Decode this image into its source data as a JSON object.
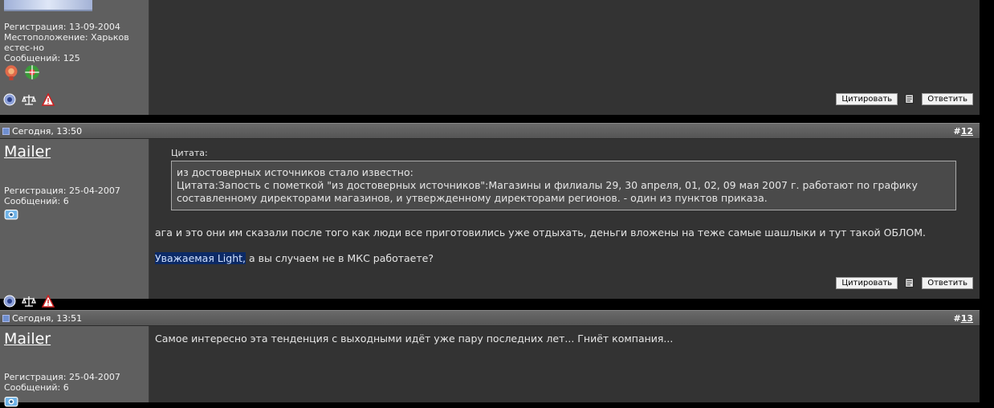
{
  "post11": {
    "registration": "Регистрация: 13-09-2004",
    "location": "Местоположение: Харьков",
    "location_extra": "естес-но",
    "messages": "Сообщений: 125",
    "quote_button": "Цитировать",
    "reply_button": "Ответить"
  },
  "post12": {
    "date": "Сегодня, 13:50",
    "number_prefix": "#",
    "number": "12",
    "username": "Mailer",
    "registration": "Регистрация: 25-04-2007",
    "messages": "Сообщений: 6",
    "quote_label": "Цитата:",
    "quote_line1": "из достоверных источников стало известно:",
    "quote_line2": "Цитата:Запость с пометкой \"из достоверных источников\":Магазины и филиалы 29, 30 апреля, 01, 02, 09 мая 2007 г. работают по графику",
    "quote_line3": "составленному директорами магазинов, и утвержденному директорами регионов. - один из пунктов приказа.",
    "body_line1": "ага и это они им сказали после того как люди все приготовились уже отдыхать, деньги вложены на теже самые шашлыки и тут такой ОБЛОМ.",
    "body_highlight": "Уважаемая Light,",
    "body_line2_rest": " а вы случаем не в МКС работаете?",
    "quote_button": "Цитировать",
    "reply_button": "Ответить"
  },
  "post13": {
    "date": "Сегодня, 13:51",
    "number_prefix": "#",
    "number": "13",
    "username": "Mailer",
    "registration": "Регистрация: 25-04-2007",
    "messages": "Сообщений: 6",
    "body_line1": "Самое интересно эта тенденция с выходными идёт уже пару последних лет... Гниёт компания..."
  },
  "colors": {
    "left_panel": "#5f5f5f",
    "right_panel": "#333333",
    "highlight": "#0c2a66"
  }
}
